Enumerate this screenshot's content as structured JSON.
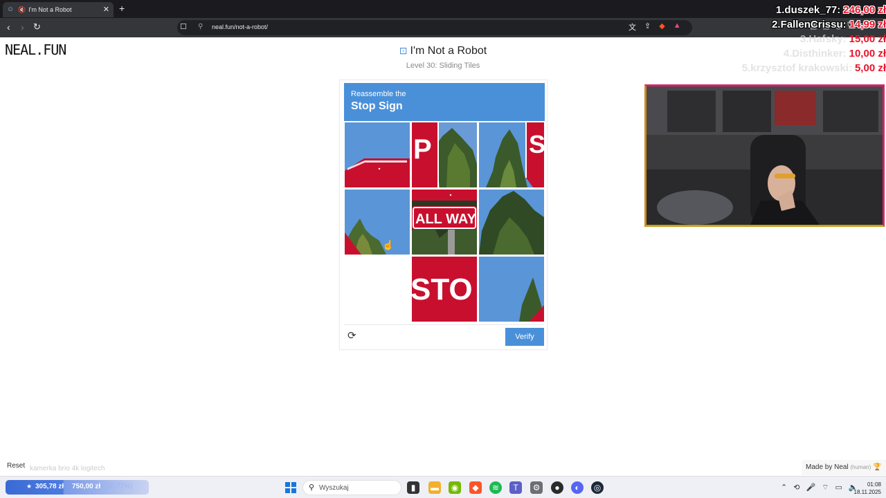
{
  "browser": {
    "tab_title": "I'm Not a Robot",
    "tab_close": "✕",
    "new_tab": "+",
    "url": "neal.fun/not-a-robot/"
  },
  "page": {
    "logo": "NEAL.FUN",
    "title": "I'm Not a Robot",
    "level": "Level 30: Sliding Tiles"
  },
  "captcha": {
    "instruction": "Reassemble the",
    "target": "Stop Sign",
    "verify_label": "Verify",
    "empty_slot": "row 3, column 1",
    "tile_texts": {
      "all_way": "ALL WAY",
      "stop_part": "STO",
      "p_letter": "P",
      "s_letter": "S"
    }
  },
  "donations": [
    {
      "name": "1.duszek_77:",
      "amount": "246,00 zł"
    },
    {
      "name": "2.FallenCrissu:",
      "amount": "14,99 zł"
    },
    {
      "name": "3.Hafsky:",
      "amount": "15,00 zł"
    },
    {
      "name": "4.Disthinker:",
      "amount": "10,00 zł"
    },
    {
      "name": "5.krzysztof krakowski:",
      "amount": "5,00 zł"
    }
  ],
  "footer": {
    "reset": "Reset",
    "cam_note": "kamerka brio 4k logitech",
    "made_by": "Made by Neal",
    "human": "(human)"
  },
  "taskbar": {
    "goal_current": "305,78 zł",
    "goal_target": "750,00 zł",
    "goal_sub": "(40,77%)",
    "search_placeholder": "Wyszukaj",
    "time": "01:08",
    "date": "18.11.2025"
  }
}
